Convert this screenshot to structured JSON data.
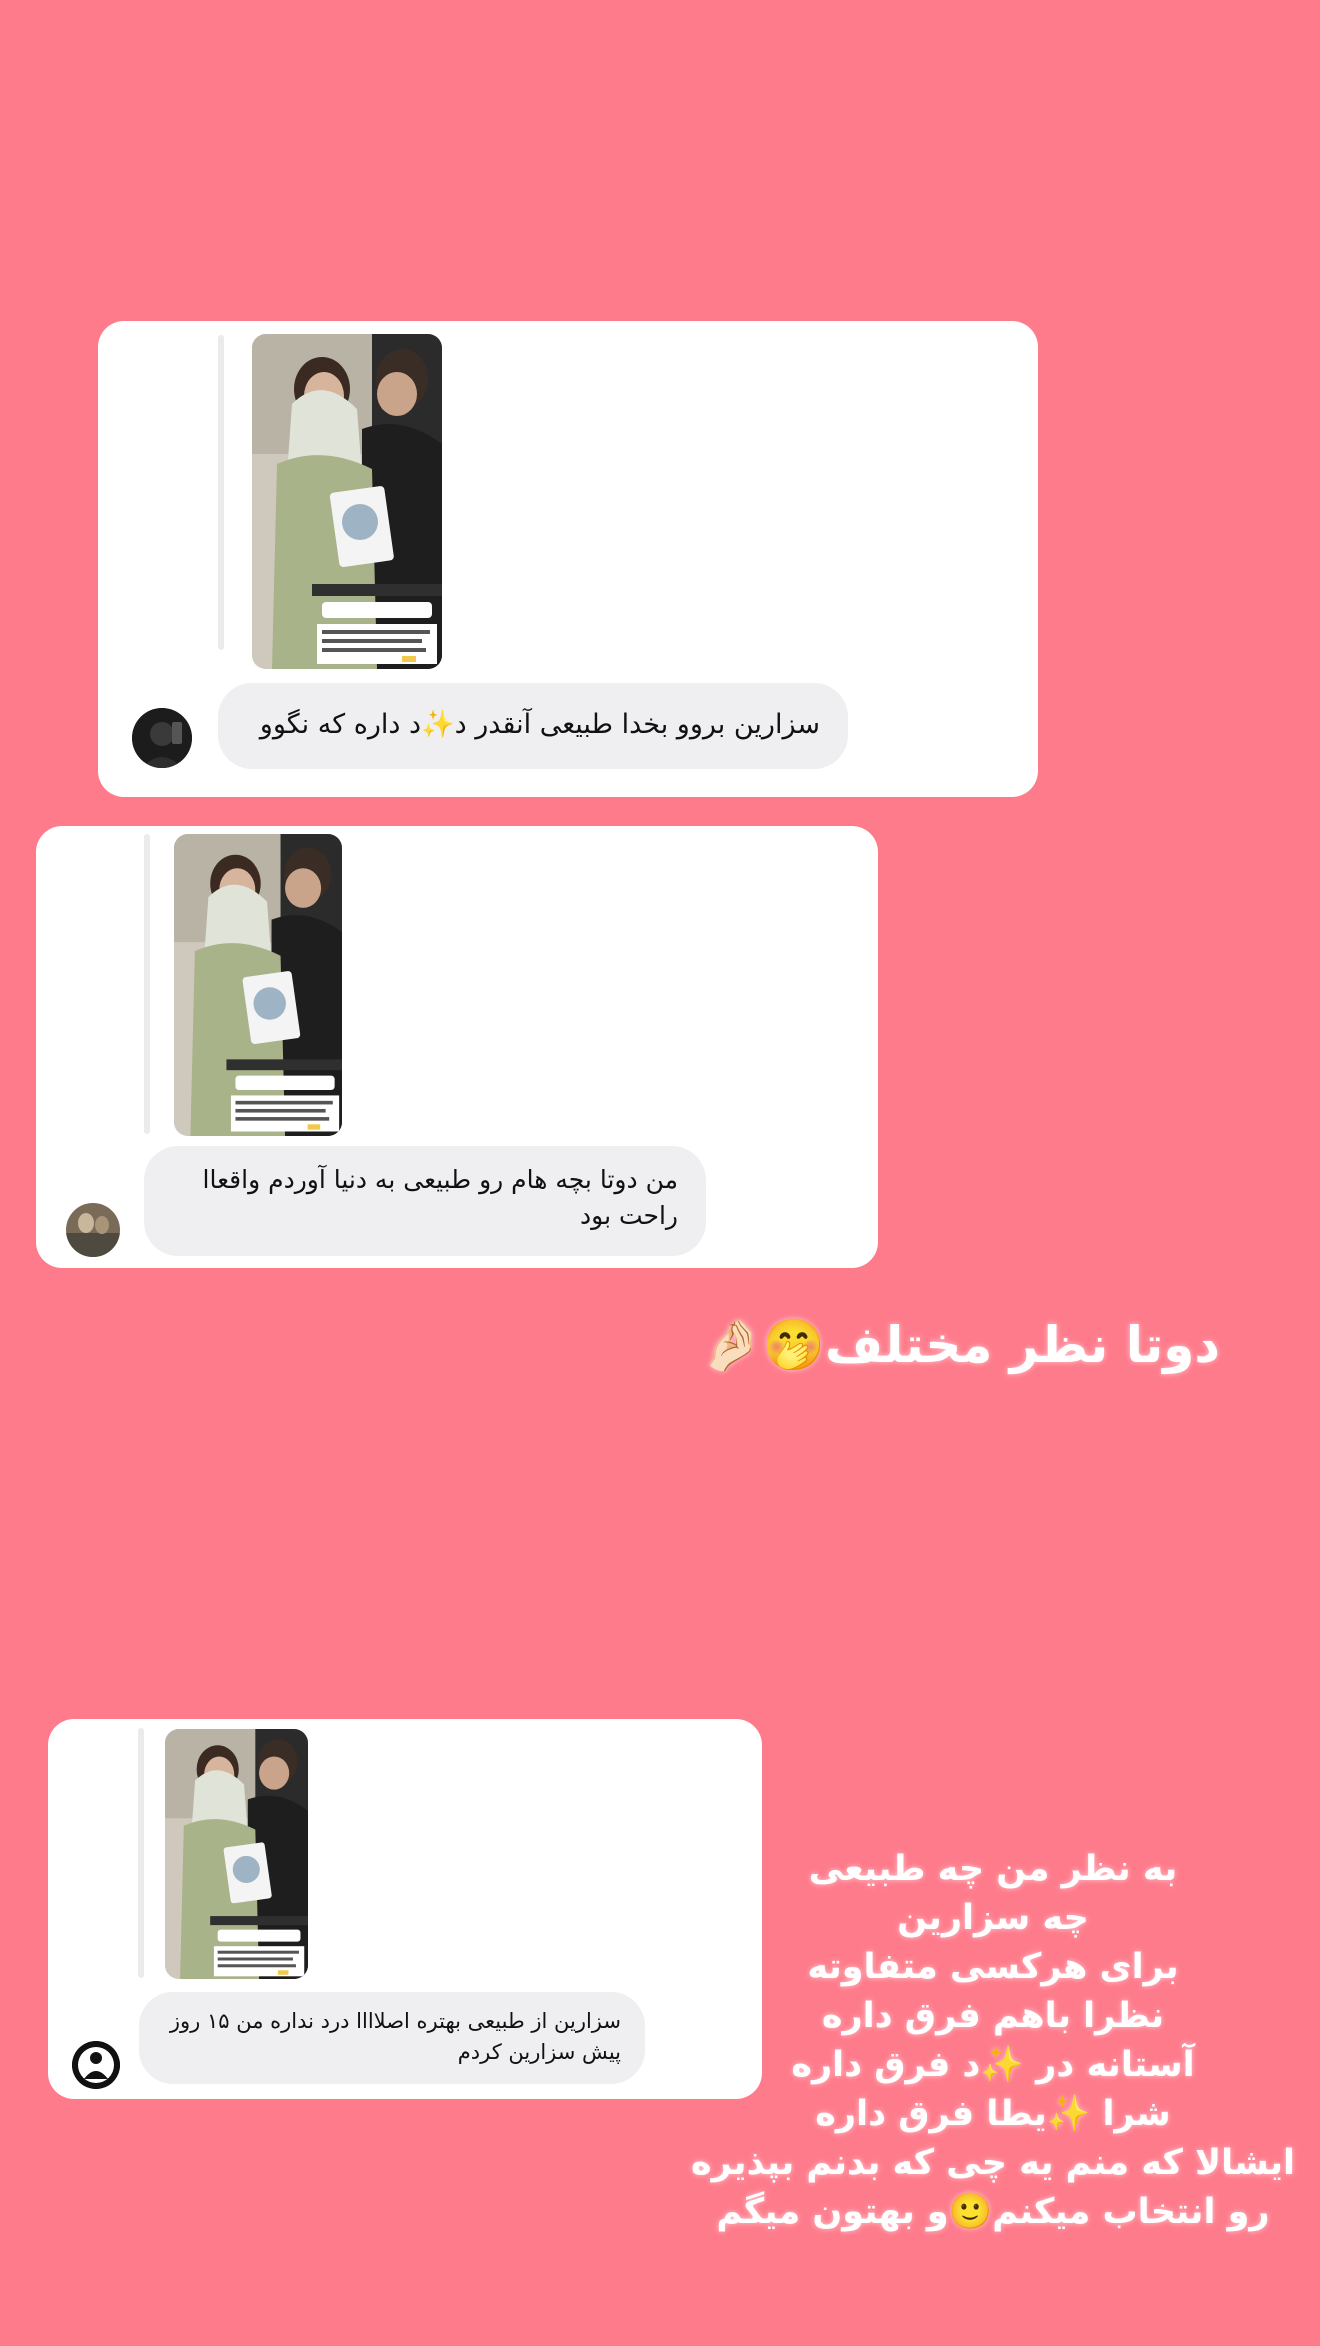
{
  "background_color": "#fe7b8b",
  "comments": [
    {
      "text": "سزارین بروو بخدا طبیعی آنقدر د✨د داره که نگوو",
      "avatar": "dark-profile-avatar"
    },
    {
      "text": "من دوتا بچه هام رو طبیعی به دنیا آوردم واقعاا راحت بود",
      "avatar": "photo-profile-avatar"
    },
    {
      "text": "سزارین از طبیعی بهتره اصلاااا درد نداره من ۱۵ روز پیش سزارین کردم",
      "avatar": "silhouette-profile-avatar"
    }
  ],
  "headline": "دوتا نظر مختلف🤭🤌🏻",
  "caption_lines": [
    "به نظر من چه طبیعی",
    "چه سزارین",
    "برای هرکسی متفاوته",
    "نظرا باهم فرق داره",
    "آستانه در ✨د فرق داره",
    "شرا ✨یطا فرق داره",
    "ایشالا که منم یه چی که بدنم بپذیره",
    "رو انتخاب میکنم🙂و بهتون میگم"
  ]
}
